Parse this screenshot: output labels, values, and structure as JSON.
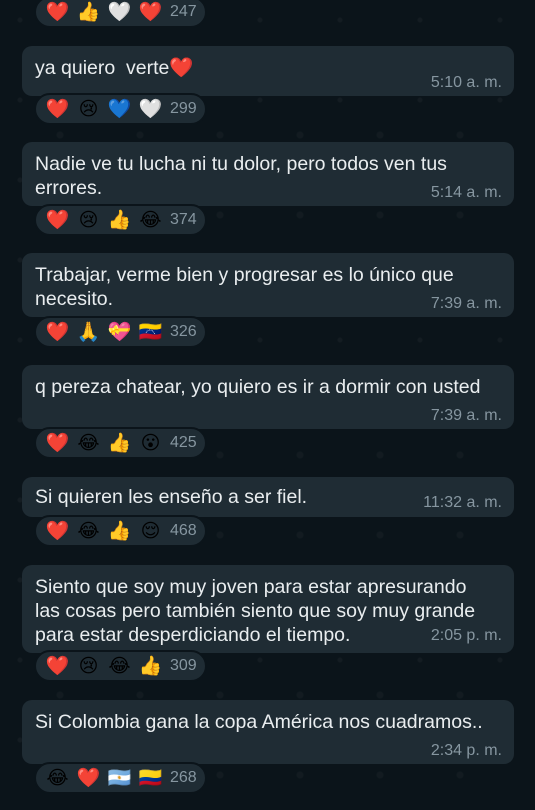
{
  "messages": [
    {
      "text": "",
      "time": "",
      "reactions": [
        "❤️",
        "👍",
        "🤍",
        "❤️"
      ],
      "count": "247"
    },
    {
      "text": "ya quiero  verte❤️",
      "time": "5:10 a. m.",
      "reactions": [
        "❤️",
        "😢",
        "💙",
        "🤍"
      ],
      "count": "299"
    },
    {
      "text": "Nadie ve tu lucha ni tu dolor, pero todos ven tus\nerrores.",
      "time": "5:14 a. m.",
      "reactions": [
        "❤️",
        "😢",
        "👍",
        "😂"
      ],
      "count": "374"
    },
    {
      "text": "Trabajar, verme bien y progresar es lo único que\nnecesito.",
      "time": "7:39 a. m.",
      "reactions": [
        "❤️",
        "🙏",
        "💝",
        "🇻🇪"
      ],
      "count": "326"
    },
    {
      "text": "q pereza chatear, yo quiero es ir a dormir con usted",
      "time": "7:39 a. m.",
      "reactions": [
        "❤️",
        "😂",
        "👍",
        "😮"
      ],
      "count": "425"
    },
    {
      "text": "Si quieren les enseño a ser fiel.",
      "time": "11:32 a. m.",
      "reactions": [
        "❤️",
        "😂",
        "👍",
        "😌"
      ],
      "count": "468"
    },
    {
      "text": "Siento que soy muy joven para estar apresurando\nlas cosas pero también siento que soy muy grande\npara estar desperdiciando el tiempo.",
      "time": "2:05 p. m.",
      "reactions": [
        "❤️",
        "😢",
        "😂",
        "👍"
      ],
      "count": "309"
    },
    {
      "text": "Si Colombia gana la copa América nos cuadramos..",
      "time": "2:34 p. m.",
      "reactions": [
        "😂",
        "❤️",
        "🇦🇷",
        "🇨🇴"
      ],
      "count": "268"
    }
  ]
}
